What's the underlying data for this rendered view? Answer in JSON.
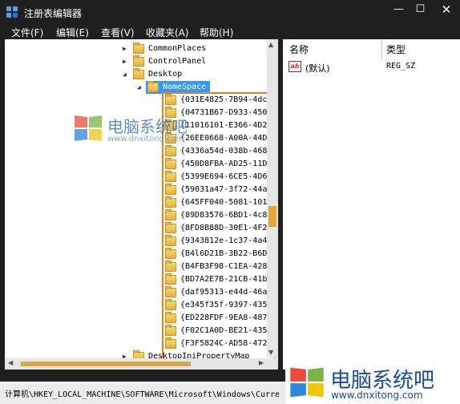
{
  "window": {
    "title": "注册表编辑器",
    "min_glyph": "—",
    "max_glyph": "☐",
    "close_glyph": "✕"
  },
  "menu": [
    {
      "label": "文件(F)"
    },
    {
      "label": "编辑(E)"
    },
    {
      "label": "查看(V)"
    },
    {
      "label": "收藏夹(A)"
    },
    {
      "label": "帮助(H)"
    }
  ],
  "tree": {
    "top_items": [
      {
        "label": "CommonPlaces",
        "expanded": false
      },
      {
        "label": "ControlPanel",
        "expanded": false
      },
      {
        "label": "Desktop",
        "expanded": true
      }
    ],
    "selected": {
      "label": "NameSpace",
      "expanded": true
    },
    "children": [
      "{031E4825-7B94-4dc",
      "{04731B67-D933-450",
      "{11016101-E366-4D2",
      "{26EE0668-A00A-44D",
      "{4336a54d-038b-468",
      "{450D8FBA-AD25-11D",
      "{5399E694-6CE5-4D6",
      "{59031a47-3f72-44a",
      "{645FF040-5081-101",
      "{89D83576-6BD1-4c8",
      "{8FD8B88D-30E1-4F2",
      "{9343812e-1c37-4a4",
      "{B4l6D21B-3B22-B6D",
      "{B4FB3F98-C1EA-428",
      "{BD7A2E7B-21CB-41b",
      "{daf95313-e44d-46a",
      "{e345f35f-9397-435",
      "{ED228FDF-9EA8-487",
      "{F02C1A0D-BE21-435",
      "{F3F5824C-AD58-472"
    ],
    "after": {
      "label": "DesktopIniPropertyMap",
      "expanded": false
    }
  },
  "list": {
    "col_name": "名称",
    "col_type": "类型",
    "rows": [
      {
        "icon": "ab",
        "name": "(默认)",
        "type": "REG_SZ"
      }
    ]
  },
  "status": {
    "path": "计算机\\HKEY_LOCAL_MACHINE\\SOFTWARE\\Microsoft\\Windows\\Curre"
  },
  "watermark": {
    "title": "电脑系统吧",
    "url": "www.dnxitong.com"
  },
  "colors": {
    "highlight_box": "#e67e22",
    "selection": "#3399ff",
    "chrome": "#1f1f1f"
  },
  "icons": {
    "folder": "folder-icon",
    "expand": "▶",
    "collapse": "◢",
    "reg_string": "ab"
  }
}
